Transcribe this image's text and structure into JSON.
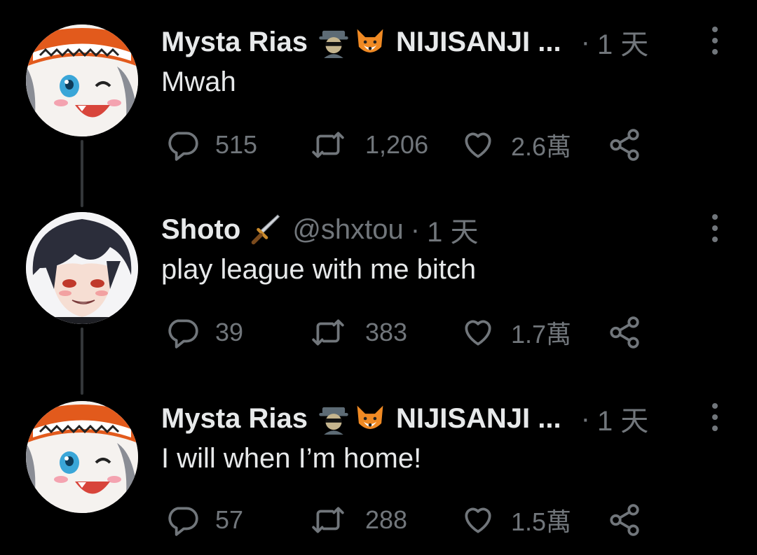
{
  "tweets": [
    {
      "author": "Mysta Rias",
      "emoji1": "detective-emoji",
      "emoji2": "fox-emoji",
      "org": "NIJISANJI ...",
      "handle": "",
      "dot": "·",
      "time": "1 天",
      "text": "Mwah",
      "replies": "515",
      "retweets": "1,206",
      "likes": "2.6萬"
    },
    {
      "author": "Shoto",
      "emoji1": "dagger-emoji",
      "emoji2": "",
      "org": "",
      "handle": "@shxtou",
      "dot": "·",
      "time": "1 天",
      "text": "play league with me bitch",
      "replies": "39",
      "retweets": "383",
      "likes": "1.7萬"
    },
    {
      "author": "Mysta Rias",
      "emoji1": "detective-emoji",
      "emoji2": "fox-emoji",
      "org": "NIJISANJI ...",
      "handle": "",
      "dot": "·",
      "time": "1 天",
      "text": "I will when I’m home!",
      "replies": "57",
      "retweets": "288",
      "likes": "1.5萬"
    }
  ],
  "colors": {
    "background": "#000000",
    "primary_text": "#e7e9ea",
    "secondary_text": "#71767b",
    "thread_line": "#333639"
  }
}
